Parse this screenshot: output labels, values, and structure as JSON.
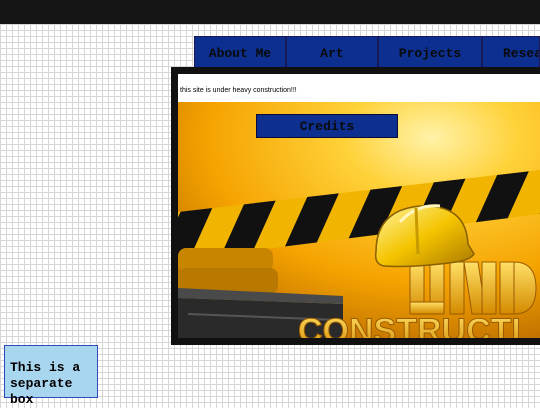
{
  "nav": {
    "items": [
      {
        "label": "About Me"
      },
      {
        "label": "Art"
      },
      {
        "label": "Projects"
      },
      {
        "label": "Resea"
      }
    ]
  },
  "banner": {
    "notice": "this site is under heavy construction!!!",
    "image_text": "UNDER CONSTRUCTION"
  },
  "credits": {
    "label": "Credits"
  },
  "separate_box": {
    "line1": "This is a",
    "line2": "separate",
    "line3": "box"
  },
  "colors": {
    "nav_bg": "#0d2f8f",
    "box_bg": "#a9d6ef",
    "topbar": "#141414"
  }
}
